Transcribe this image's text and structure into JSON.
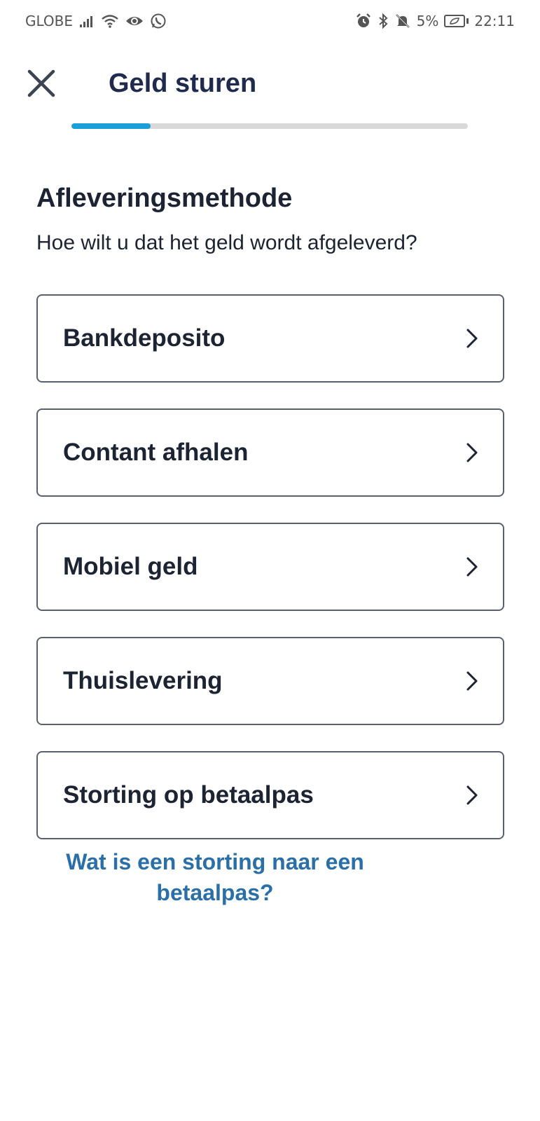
{
  "status_bar": {
    "carrier": "GLOBE",
    "battery": "5%",
    "time": "22:11",
    "icons_left": [
      "signal-icon",
      "wifi-icon",
      "eye-icon",
      "whatsapp-icon"
    ],
    "icons_right": [
      "alarm-icon",
      "bluetooth-icon",
      "mute-icon",
      "battery-icon"
    ]
  },
  "header": {
    "title": "Geld sturen",
    "close_icon": "close-icon"
  },
  "progress": {
    "fraction": 0.2,
    "track_color": "#d9d9d9",
    "fill_color": "#1a9fd9"
  },
  "section": {
    "title": "Afleveringsmethode",
    "subtitle": "Hoe wilt u dat het geld wordt afgeleverd?"
  },
  "options": [
    {
      "label": "Bankdeposito",
      "icon": "chevron-right-icon"
    },
    {
      "label": "Contant afhalen",
      "icon": "chevron-right-icon"
    },
    {
      "label": "Mobiel geld",
      "icon": "chevron-right-icon"
    },
    {
      "label": "Thuislevering",
      "icon": "chevron-right-icon"
    },
    {
      "label": "Storting op betaalpas",
      "icon": "chevron-right-icon"
    }
  ],
  "help_link": {
    "text": "Wat is een storting naar een betaalpas?",
    "color": "#2a6fa8"
  }
}
